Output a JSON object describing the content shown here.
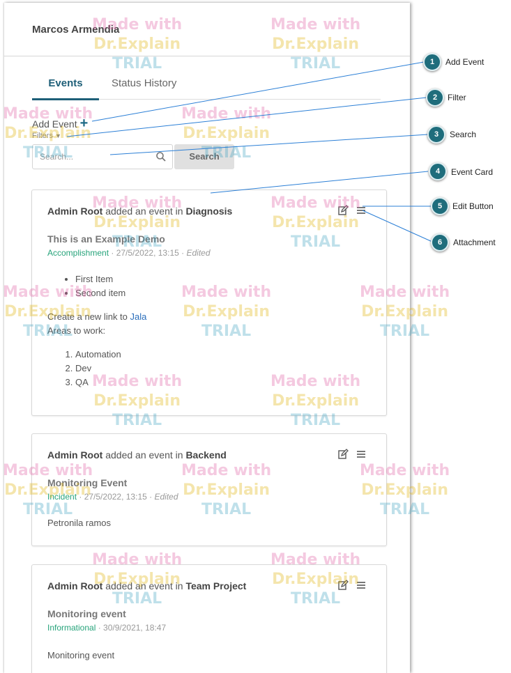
{
  "panel": {
    "user_name": "Marcos Armendia",
    "tabs": [
      {
        "label": "Events",
        "active": true
      },
      {
        "label": "Status History",
        "active": false
      }
    ],
    "add_event_label": "Add Event",
    "filter_label": "Filters",
    "search": {
      "placeholder": "Search...",
      "button_label": "Search"
    }
  },
  "events": [
    {
      "actor": "Admin Root",
      "action": "added an event in",
      "target": "Diagnosis",
      "title_prefix": "This is an",
      "title_emph": "Example Demo",
      "type": "Accomplishment",
      "timestamp": "27/5/2022, 13:15",
      "edited": "Edited",
      "list_items": [
        "First Item",
        "Second item"
      ],
      "link_text_prefix": "Create a new link to",
      "link_text": "Jala",
      "areas_label": "Areas to work:",
      "ordered_items": [
        "Automation",
        "Dev",
        "QA"
      ]
    },
    {
      "actor": "Admin Root",
      "action": "added an event in",
      "target": "Backend",
      "title": "Monitoring Event",
      "type": "Incident",
      "timestamp": "27/5/2022, 13:15",
      "edited": "Edited",
      "body": "Petronila ramos"
    },
    {
      "actor": "Admin Root",
      "action": "added an event in",
      "target": "Team Project",
      "title": "Monitoring event",
      "type": "Informational",
      "timestamp": "30/9/2021, 18:47",
      "body": "Monitoring event"
    }
  ],
  "watermark": {
    "line1": "Made with",
    "line2": "Dr.Explain",
    "line3": "TRIAL"
  },
  "callouts": [
    {
      "num": "1",
      "label": "Add Event"
    },
    {
      "num": "2",
      "label": "Filter"
    },
    {
      "num": "3",
      "label": "Search"
    },
    {
      "num": "4",
      "label": "Event Card"
    },
    {
      "num": "5",
      "label": "Edit Button"
    },
    {
      "num": "6",
      "label": "Attachment"
    }
  ],
  "colors": {
    "accent": "#1e5f78",
    "type_green": "#26a37a",
    "link": "#2a6ebb",
    "callout": "#1f6d7c"
  }
}
